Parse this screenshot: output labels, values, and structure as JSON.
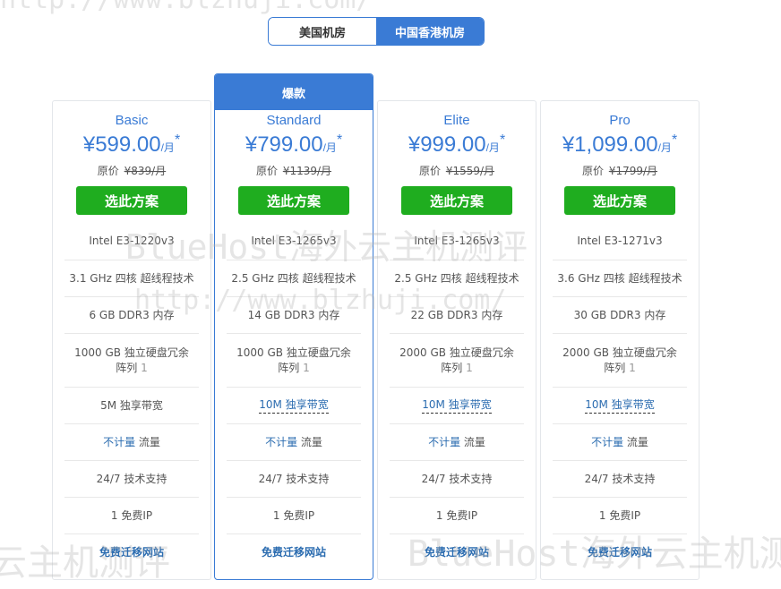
{
  "tabs": [
    {
      "label": "美国机房",
      "active": false
    },
    {
      "label": "中国香港机房",
      "active": true
    }
  ],
  "featured_banner": "爆款",
  "select_label": "选此方案",
  "orig_label": "原价",
  "plans": [
    {
      "name": "Basic",
      "currency": "¥",
      "price": "599.00",
      "per": "/月",
      "star": "*",
      "orig_price": "¥839/月",
      "cpu": "Intel E3-1220v3",
      "cores_ghz": "3.1 GHz",
      "cores_text": "四核 超线程技术",
      "ram": "6 GB DDR3 内存",
      "disk": "1000 GB 独立硬盘冗余",
      "raid_label": "阵列",
      "raid_num": "1",
      "bandwidth": "5M 独享带宽",
      "traffic_a": "不计量",
      "traffic_b": "流量",
      "support": "24/7 技术支持",
      "ip": "1 免费IP",
      "migrate": "免费迁移网站"
    },
    {
      "name": "Standard",
      "currency": "¥",
      "price": "799.00",
      "per": "/月",
      "star": "*",
      "orig_price": "¥1139/月",
      "cpu": "Intel E3-1265v3",
      "cores_ghz": "2.5 GHz",
      "cores_text": "四核 超线程技术",
      "ram": "14 GB DDR3 内存",
      "disk": "1000 GB 独立硬盘冗余",
      "raid_label": "阵列",
      "raid_num": "1",
      "bandwidth": "10M 独享带宽",
      "traffic_a": "不计量",
      "traffic_b": "流量",
      "support": "24/7 技术支持",
      "ip": "1 免费IP",
      "migrate": "免费迁移网站"
    },
    {
      "name": "Elite",
      "currency": "¥",
      "price": "999.00",
      "per": "/月",
      "star": "*",
      "orig_price": "¥1559/月",
      "cpu": "Intel E3-1265v3",
      "cores_ghz": "2.5 GHz",
      "cores_text": "四核 超线程技术",
      "ram": "22 GB DDR3 内存",
      "disk": "2000 GB 独立硬盘冗余",
      "raid_label": "阵列",
      "raid_num": "1",
      "bandwidth": "10M 独享带宽",
      "traffic_a": "不计量",
      "traffic_b": "流量",
      "support": "24/7 技术支持",
      "ip": "1 免费IP",
      "migrate": "免费迁移网站"
    },
    {
      "name": "Pro",
      "currency": "¥",
      "price": "1,099.00",
      "per": "/月",
      "star": "*",
      "orig_price": "¥1799/月",
      "cpu": "Intel E3-1271v3",
      "cores_ghz": "3.6 GHz",
      "cores_text": "四核 超线程技术",
      "ram": "30 GB DDR3 内存",
      "disk": "2000 GB 独立硬盘冗余",
      "raid_label": "阵列",
      "raid_num": "1",
      "bandwidth": "10M 独享带宽",
      "traffic_a": "不计量",
      "traffic_b": "流量",
      "support": "24/7 技术支持",
      "ip": "1 免费IP",
      "migrate": "免费迁移网站"
    }
  ],
  "watermarks": {
    "url": "http://www.blzhuji.com/",
    "brand": "BlueHost海外云主机测评",
    "brand_partial": "云主机测评"
  },
  "colors": {
    "accent": "#3a7bd5",
    "button_green": "#1fad1f",
    "link_blue": "#2b6cb0"
  }
}
